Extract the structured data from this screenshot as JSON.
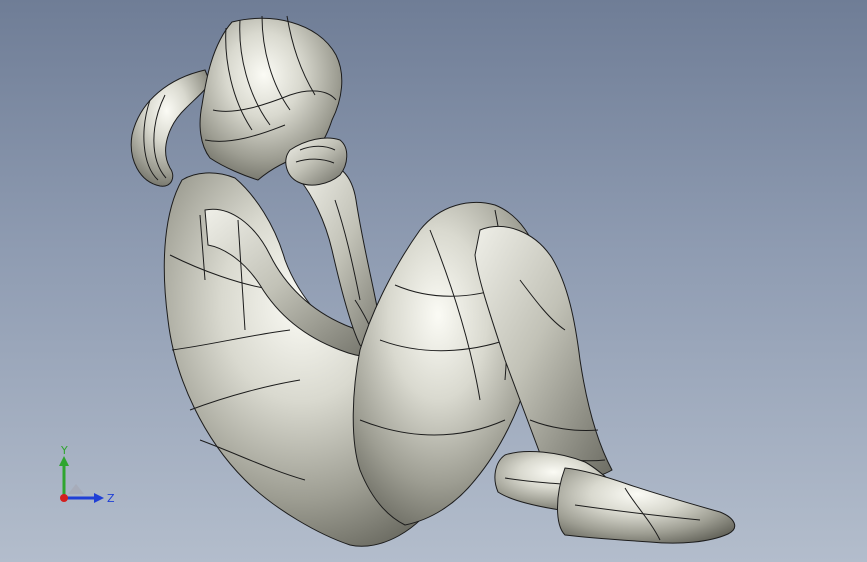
{
  "viewport": {
    "background_top": "#6f7d96",
    "background_bottom": "#b3bdcc",
    "model_color": "#c9c9c0",
    "edge_color": "#1c1c1c"
  },
  "triad": {
    "y_label": "Y",
    "z_label": "Z",
    "y_color": "#2fa52f",
    "z_color": "#1f3fd6",
    "x_color": "#d31f1f"
  }
}
